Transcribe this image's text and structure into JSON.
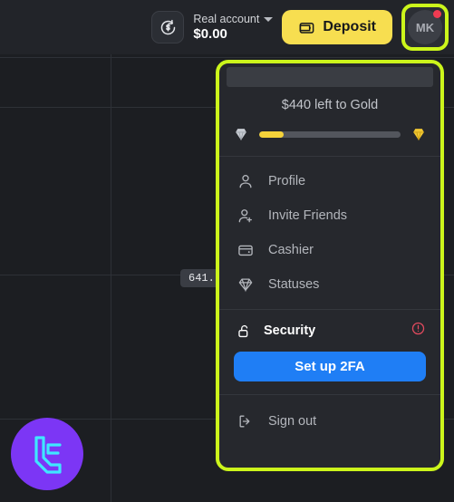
{
  "top_bar": {
    "account_switch_icon": "refresh-dollar-icon",
    "account_type": "Real account",
    "balance": "$0.00",
    "chevron_icon": "chevron-down-icon",
    "deposit_label": "Deposit",
    "deposit_icon": "wallet-icon",
    "avatar_initials": "MK",
    "notification_dot": true,
    "accent_color": "#f7de50",
    "highlight_color": "#ccf61b"
  },
  "chart": {
    "price_label": "641.",
    "background_color": "#1c1e22",
    "gridline_color": "#2e3137"
  },
  "brand": {
    "logo_icon": "lc-monogram-logo",
    "logo_bg_color": "#7c36f5",
    "logo_stroke_color": "#3fe7ff"
  },
  "profile_panel": {
    "status": {
      "text": "$440 left to Gold",
      "left_icon": "silver-diamond-icon",
      "right_icon": "gold-diamond-icon",
      "progress_percent": 17,
      "progress_fill_color": "#f5d33a"
    },
    "menu_items": [
      {
        "label": "Profile",
        "icon": "user-icon"
      },
      {
        "label": "Invite Friends",
        "icon": "user-plus-icon"
      },
      {
        "label": "Cashier",
        "icon": "wallet-icon"
      },
      {
        "label": "Statuses",
        "icon": "diamond-icon"
      }
    ],
    "security": {
      "title": "Security",
      "icon": "unlock-icon",
      "alert_icon": "alert-circle-icon",
      "alert_color": "#e24a5e",
      "button_label": "Set up 2FA",
      "button_color": "#1f7ef5"
    },
    "sign_out": {
      "label": "Sign out",
      "icon": "logout-icon"
    }
  }
}
